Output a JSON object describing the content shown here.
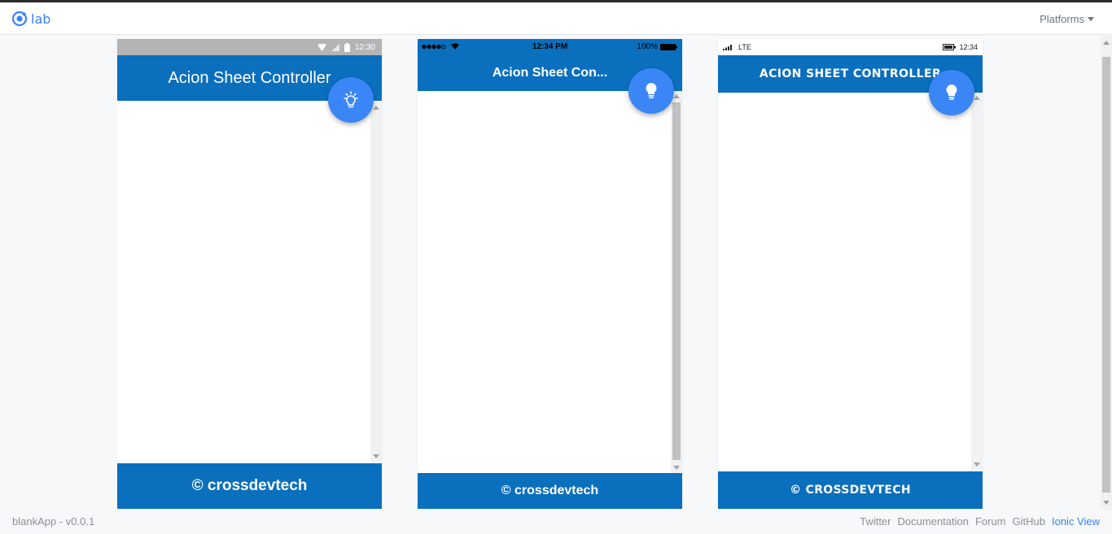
{
  "header": {
    "logo_text": "lab",
    "platforms_label": "Platforms",
    "accent": "#3880ff"
  },
  "devices": {
    "android": {
      "status_time": "12:30",
      "title": "Acion Sheet Controller",
      "footer": "© crossdevtech",
      "fab_icon": "bulb-outline-icon"
    },
    "ios": {
      "status_time": "12:34 PM",
      "status_battery": "100%",
      "title": "Acion Sheet Con...",
      "footer": "© crossdevtech",
      "fab_icon": "bulb-icon"
    },
    "windows": {
      "status_network": "LTE",
      "status_time": "12:34",
      "title": "ACION SHEET CONTROLLER",
      "footer": "© CROSSDEVTECH",
      "fab_icon": "bulb-icon"
    }
  },
  "colors": {
    "toolbar": "#0a6fbd",
    "fab": "#3a86f7"
  },
  "bottom": {
    "version": "blankApp - v0.0.1",
    "links": [
      "Twitter",
      "Documentation",
      "Forum",
      "GitHub",
      "Ionic View"
    ]
  }
}
